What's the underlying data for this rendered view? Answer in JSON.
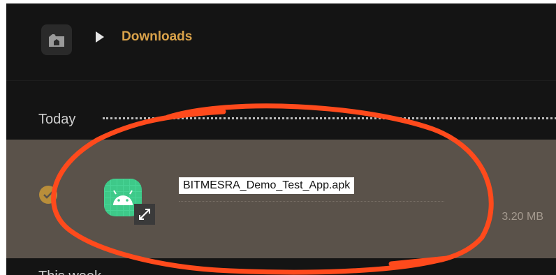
{
  "breadcrumb": {
    "current": "Downloads",
    "home_icon": "home-icon",
    "separator_icon": "chevron-right-icon"
  },
  "sections": {
    "today": "Today",
    "this_week": "This week"
  },
  "file": {
    "name": "BITMESRA_Demo_Test_App.apk",
    "size": "3.20 MB",
    "icon": "android-icon",
    "selected": true
  },
  "colors": {
    "accent": "#d9a24a",
    "row_selected": "#5a524a",
    "background": "#141414",
    "annotation": "#ff4a1c"
  }
}
